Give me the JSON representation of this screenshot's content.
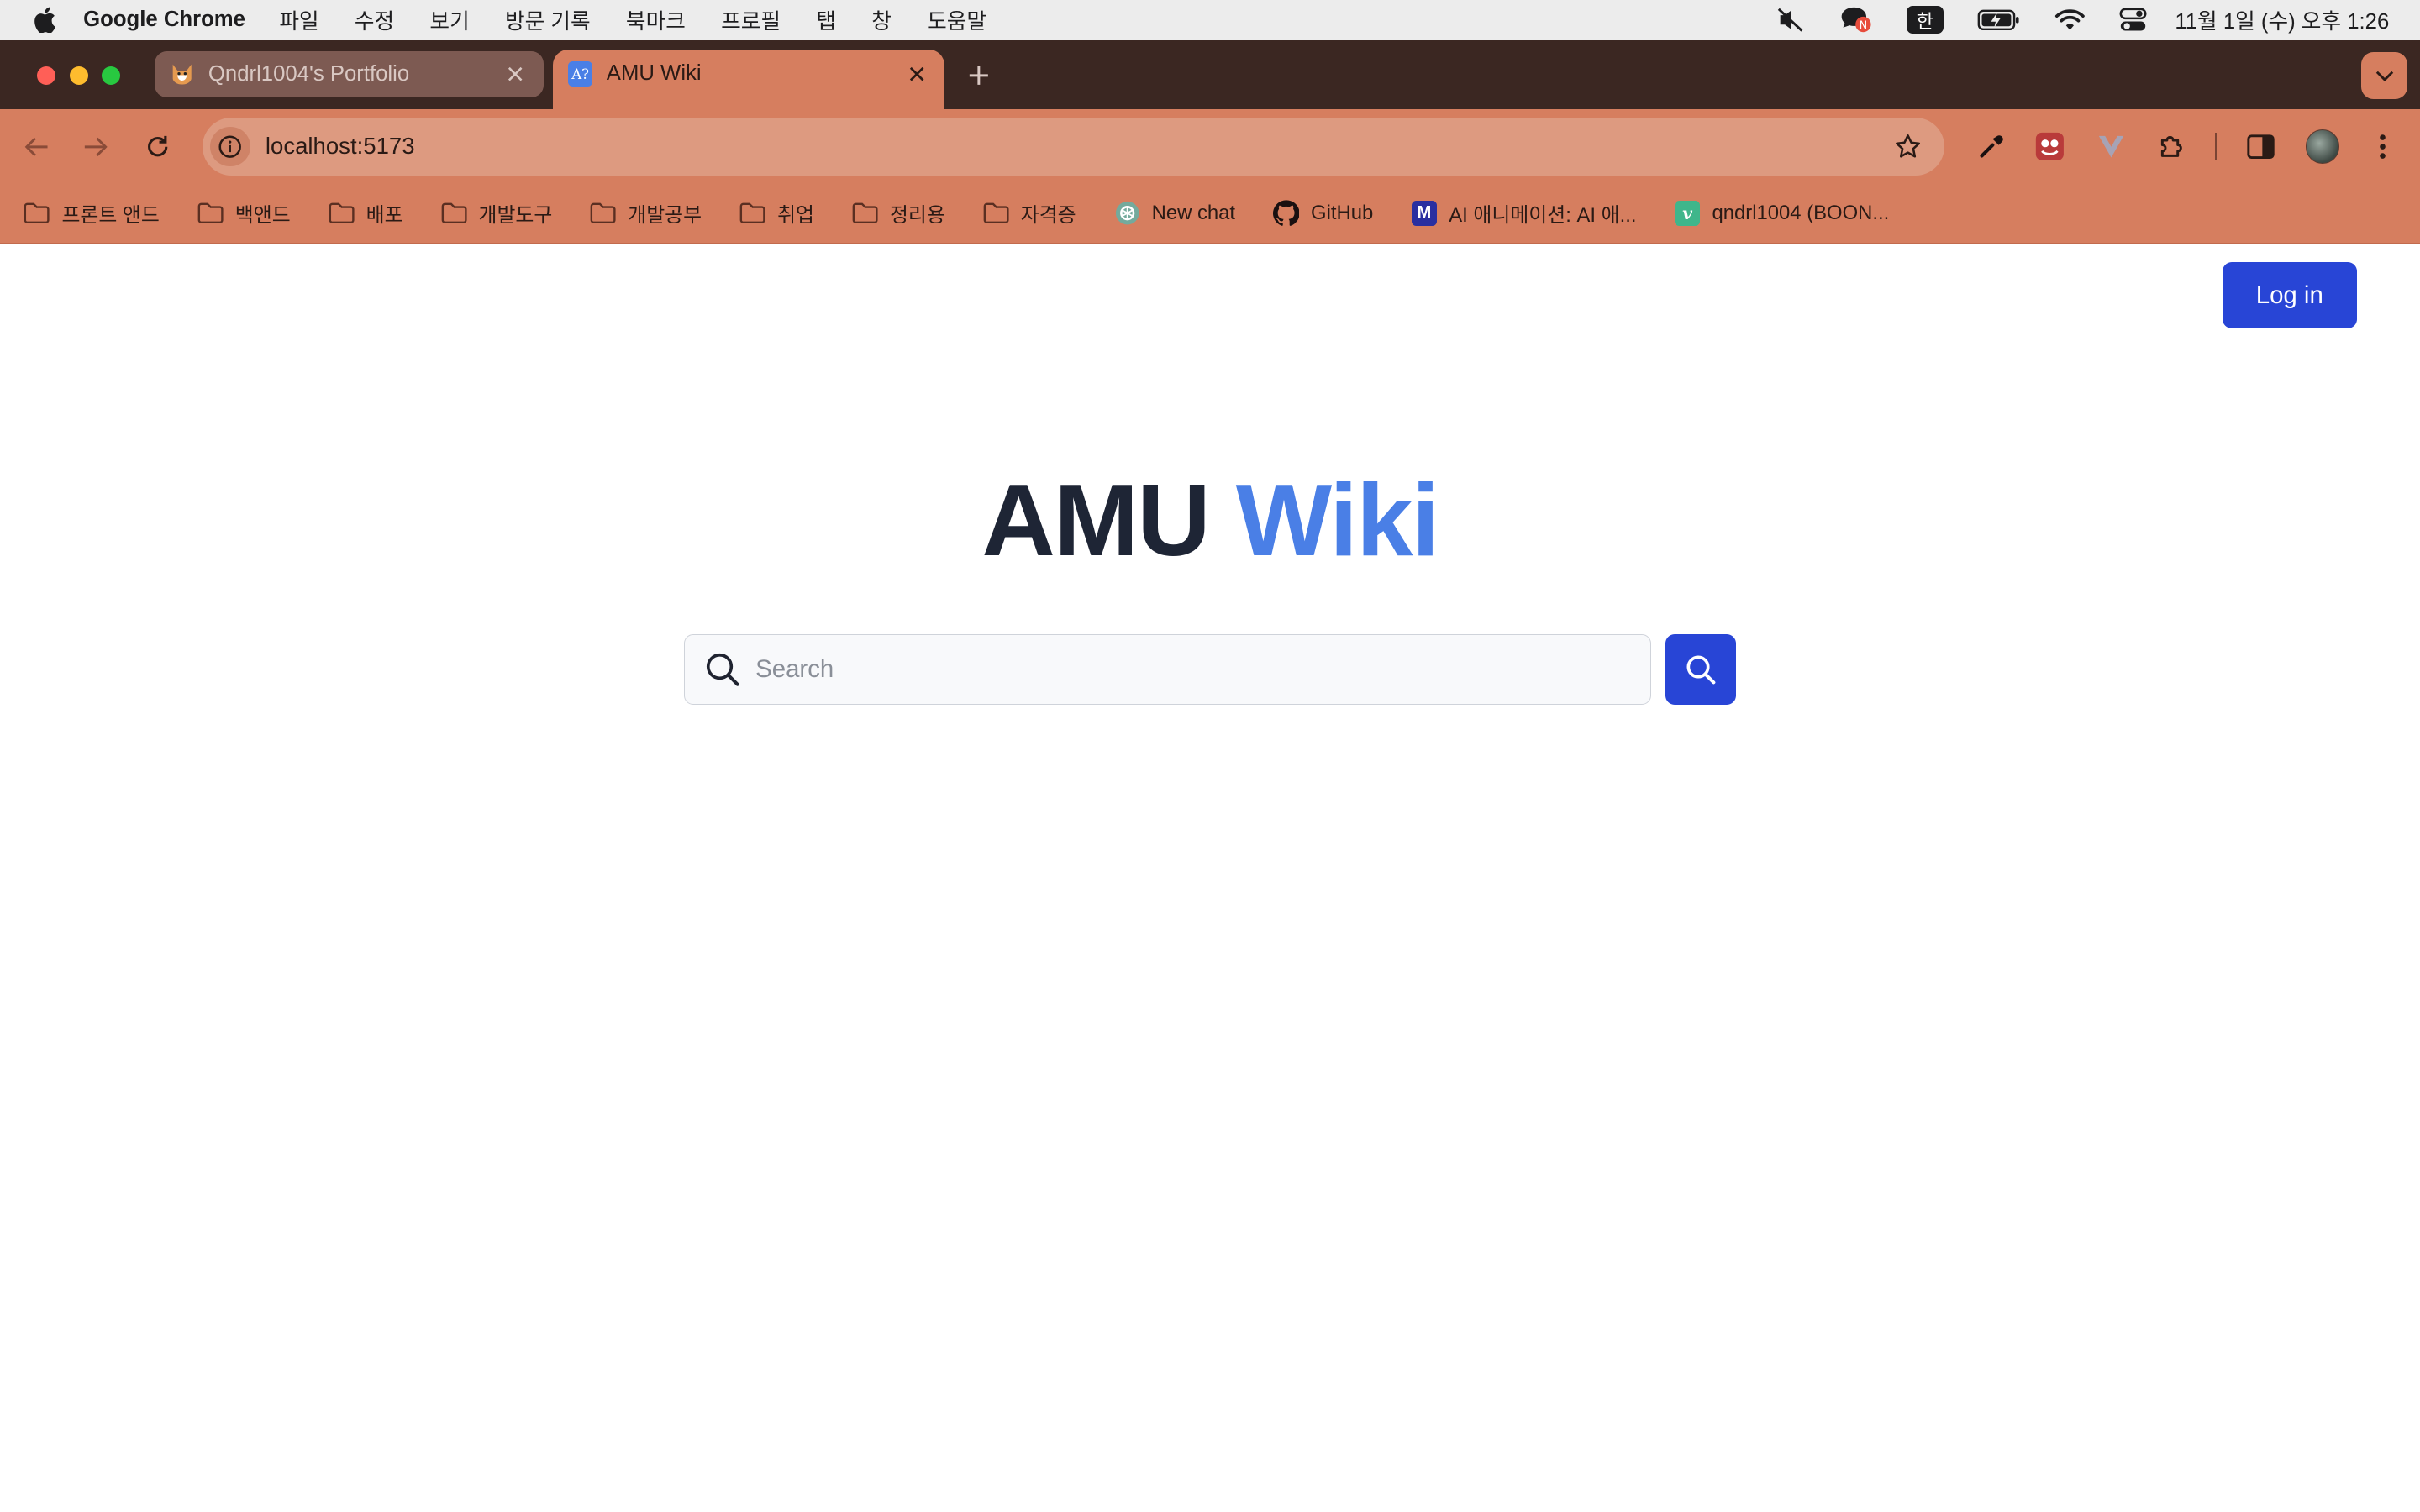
{
  "menubar": {
    "app_name": "Google Chrome",
    "items": [
      "파일",
      "수정",
      "보기",
      "방문 기록",
      "북마크",
      "프로필",
      "탭",
      "창",
      "도움말"
    ],
    "ime_label": "한",
    "clock": "11월 1일 (수) 오후 1:26"
  },
  "tabs": [
    {
      "title": "Qndrl1004's Portfolio",
      "active": false
    },
    {
      "title": "AMU Wiki",
      "active": true,
      "favicon_text": "A?"
    }
  ],
  "toolbar": {
    "url": "localhost:5173"
  },
  "bookmarks": [
    {
      "label": "프론트 앤드",
      "icon": "folder-icon"
    },
    {
      "label": "백앤드",
      "icon": "folder-icon"
    },
    {
      "label": "배포",
      "icon": "folder-icon"
    },
    {
      "label": "개발도구",
      "icon": "folder-icon"
    },
    {
      "label": "개발공부",
      "icon": "folder-icon"
    },
    {
      "label": "취업",
      "icon": "folder-icon"
    },
    {
      "label": "정리용",
      "icon": "folder-icon"
    },
    {
      "label": "자격증",
      "icon": "folder-icon"
    },
    {
      "label": "New chat",
      "icon": "openai-icon"
    },
    {
      "label": "GitHub",
      "icon": "github-icon"
    },
    {
      "label": "AI 애니메이션: AI 애...",
      "icon": "m-badge-icon",
      "badge": "M"
    },
    {
      "label": "qndrl1004 (BOON...",
      "icon": "v-badge-icon",
      "badge": "v"
    }
  ],
  "page": {
    "login_label": "Log in",
    "title_part1": "AMU",
    "title_part2": "Wiki",
    "search_placeholder": "Search",
    "search_value": ""
  },
  "colors": {
    "chrome_theme": "#d67e5f",
    "tabstrip": "#3b2722",
    "primary_button": "#2845d6",
    "title_dark": "#1e2535",
    "title_accent": "#4a7fe6"
  }
}
